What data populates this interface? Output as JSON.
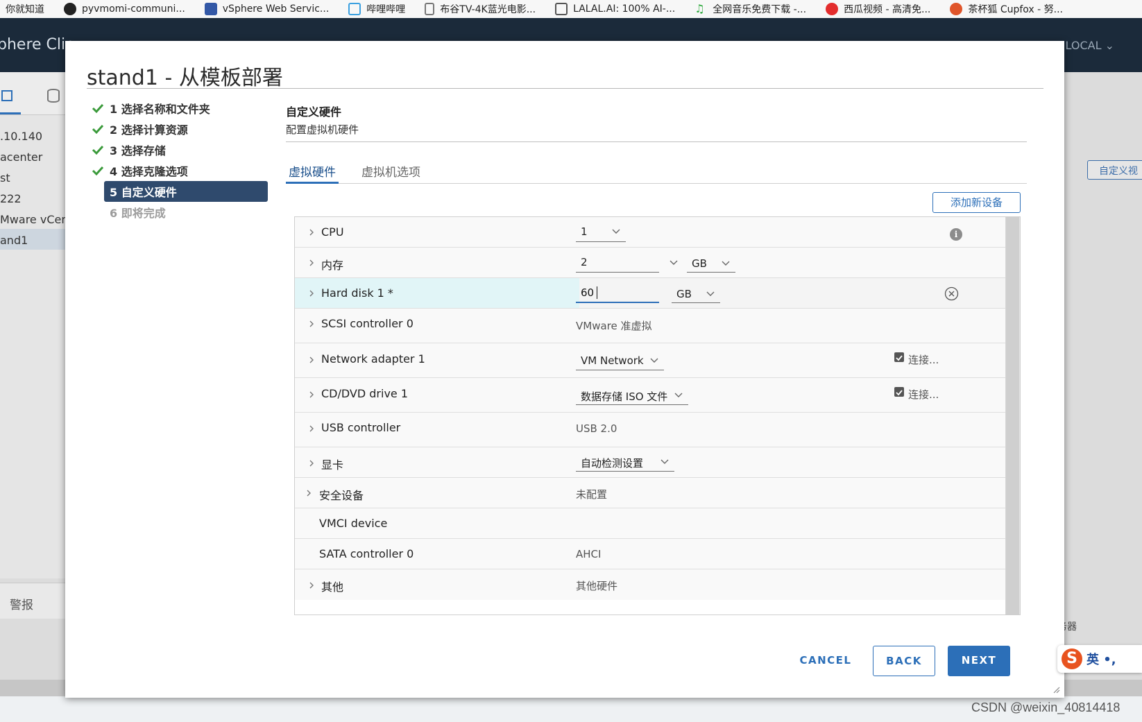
{
  "browser": {
    "bookmarks": [
      {
        "label": "你就知道",
        "icon": "page-icon",
        "color": "#ffffff"
      },
      {
        "label": "pyvmomi-communi...",
        "icon": "github-icon",
        "color": "#222222"
      },
      {
        "label": "vSphere Web Servic...",
        "icon": "vmware-icon",
        "color": "#3358a6"
      },
      {
        "label": "哔哩哔哩",
        "icon": "bilibili-icon",
        "color": "#3ba0e0"
      },
      {
        "label": "布谷TV-4K蓝光电影...",
        "icon": "doc-icon",
        "color": "#888888"
      },
      {
        "label": "LALAL.AI: 100% AI-...",
        "icon": "lalal-icon",
        "color": "#555555"
      },
      {
        "label": "全网音乐免费下载 -...",
        "icon": "music-icon",
        "color": "#2aa83a"
      },
      {
        "label": "西瓜视频 - 高清免...",
        "icon": "xigua-icon",
        "color": "#e32d2d"
      },
      {
        "label": "茶杯狐 Cupfox - 努...",
        "icon": "cupfox-icon",
        "color": "#e0552a"
      }
    ]
  },
  "app": {
    "title": "phere Clie",
    "user": "LOCAL",
    "left_items": [
      ".10.140",
      "acenter",
      "st",
      " 222",
      "Mware vCen",
      "and1"
    ],
    "alerts_label": "警报",
    "right_button": "自定义视",
    "right_server": "服务器"
  },
  "modal": {
    "title": "stand1 - 从模板部署",
    "steps": [
      {
        "label": "1 选择名称和文件夹",
        "state": "done"
      },
      {
        "label": "2 选择计算资源",
        "state": "done"
      },
      {
        "label": "3 选择存储",
        "state": "done"
      },
      {
        "label": "4 选择克隆选项",
        "state": "done"
      },
      {
        "label": "5 自定义硬件",
        "state": "active"
      },
      {
        "label": "6 即将完成",
        "state": "future"
      }
    ],
    "section_title": "自定义硬件",
    "section_subtitle": "配置虚拟机硬件",
    "tabs": [
      {
        "label": "虚拟硬件",
        "active": true
      },
      {
        "label": "虚拟机选项",
        "active": false
      }
    ],
    "add_device_button": "添加新设备",
    "hardware": {
      "cpu": {
        "label": "CPU",
        "value": "1"
      },
      "memory": {
        "label": "内存",
        "value": "2",
        "unit": "GB"
      },
      "hard_disk": {
        "label": "Hard disk 1 *",
        "value": "60",
        "unit": "GB"
      },
      "scsi": {
        "label": "SCSI controller 0",
        "value": "VMware 准虚拟"
      },
      "network": {
        "label": "Network adapter 1",
        "value": "VM Network",
        "connect_label": "连接..."
      },
      "cdrom": {
        "label": "CD/DVD drive 1",
        "value": "数据存储 ISO 文件",
        "connect_label": "连接..."
      },
      "usb": {
        "label": "USB controller",
        "value": "USB 2.0"
      },
      "video": {
        "label": "显卡",
        "value": "自动检测设置"
      },
      "security": {
        "label": "安全设备",
        "value": "未配置"
      },
      "vmci": {
        "label": "VMCI device"
      },
      "sata": {
        "label": "SATA controller 0",
        "value": "AHCI"
      },
      "other": {
        "label": "其他",
        "value": "其他硬件"
      }
    },
    "buttons": {
      "cancel": "CANCEL",
      "back": "BACK",
      "next": "NEXT"
    }
  },
  "ime": {
    "logo": "S",
    "text": "英 •,"
  },
  "watermark": "CSDN @weixin_40814418",
  "colors": {
    "accent": "#2c6fb8",
    "active_step": "#2f4a6d",
    "check": "#3a9a3a",
    "header": "#1b2a3a"
  }
}
